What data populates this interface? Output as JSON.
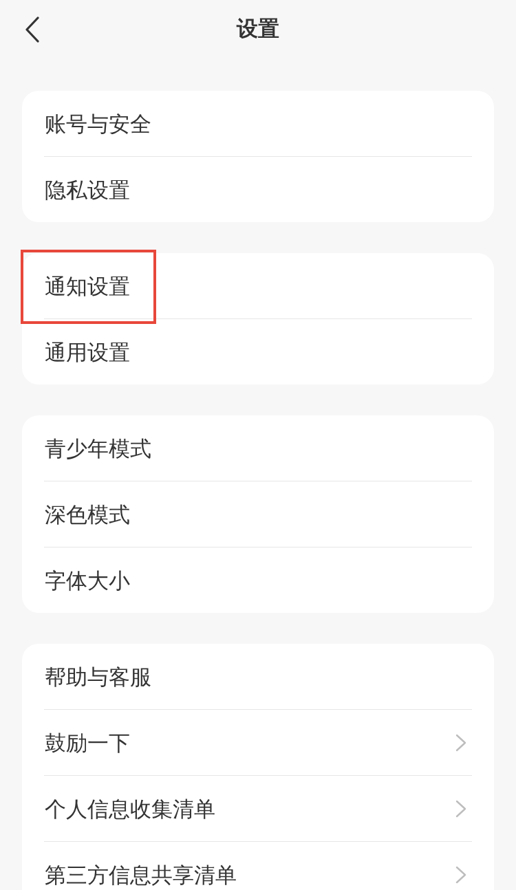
{
  "header": {
    "title": "设置"
  },
  "groups": [
    {
      "items": [
        {
          "label": "账号与安全",
          "chevron": false,
          "highlighted": false
        },
        {
          "label": "隐私设置",
          "chevron": false,
          "highlighted": false
        }
      ]
    },
    {
      "items": [
        {
          "label": "通知设置",
          "chevron": false,
          "highlighted": true
        },
        {
          "label": "通用设置",
          "chevron": false,
          "highlighted": false
        }
      ]
    },
    {
      "items": [
        {
          "label": "青少年模式",
          "chevron": false,
          "highlighted": false
        },
        {
          "label": "深色模式",
          "chevron": false,
          "highlighted": false
        },
        {
          "label": "字体大小",
          "chevron": false,
          "highlighted": false
        }
      ]
    },
    {
      "items": [
        {
          "label": "帮助与客服",
          "chevron": false,
          "highlighted": false
        },
        {
          "label": "鼓励一下",
          "chevron": true,
          "highlighted": false
        },
        {
          "label": "个人信息收集清单",
          "chevron": true,
          "highlighted": false
        },
        {
          "label": "第三方信息共享清单",
          "chevron": true,
          "highlighted": false
        }
      ]
    }
  ]
}
